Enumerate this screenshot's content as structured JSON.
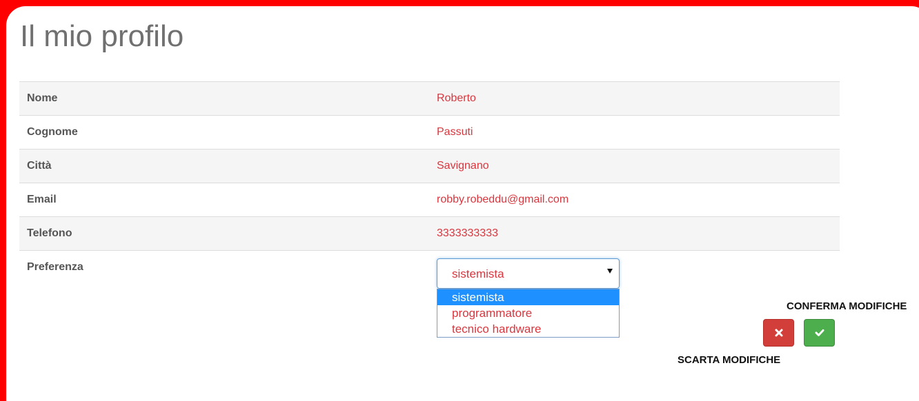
{
  "page": {
    "title": "Il mio profilo"
  },
  "profile": {
    "rows": [
      {
        "label": "Nome",
        "value": "Roberto"
      },
      {
        "label": "Cognome",
        "value": "Passuti"
      },
      {
        "label": "Città",
        "value": "Savignano"
      },
      {
        "label": "Email",
        "value": "robby.robeddu@gmail.com"
      },
      {
        "label": "Telefono",
        "value": "3333333333"
      }
    ],
    "preference": {
      "label": "Preferenza",
      "selected": "sistemista",
      "options": [
        "sistemista",
        "programmatore",
        "tecnico hardware"
      ]
    }
  },
  "actions": {
    "confirm_label": "CONFERMA MODIFICHE",
    "discard_label": "SCARTA MODIFICHE",
    "confirm_icon": "check-icon",
    "discard_icon": "close-icon"
  },
  "colors": {
    "frame": "#ff0000",
    "value_text": "#d9363e",
    "discard_button": "#d23f3a",
    "confirm_button": "#4cae4c",
    "option_highlight": "#1e90ff"
  }
}
